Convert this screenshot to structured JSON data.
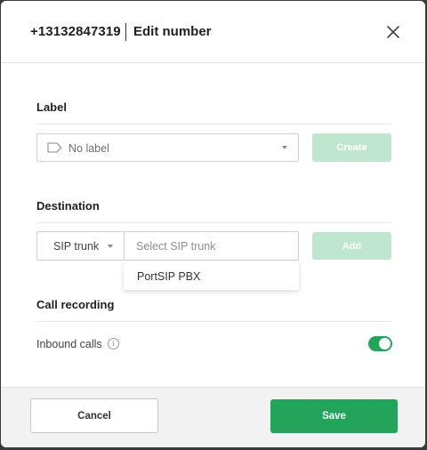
{
  "header": {
    "phone_number": "+13132847319",
    "title": "Edit number"
  },
  "label_section": {
    "title": "Label",
    "select_value": "No label",
    "create_label": "Create"
  },
  "destination_section": {
    "title": "Destination",
    "type_value": "SIP trunk",
    "trunk_placeholder": "Select SIP trunk",
    "add_label": "Add",
    "dropdown_options": [
      "PortSIP PBX"
    ]
  },
  "recording_section": {
    "title": "Call recording",
    "inbound_label": "Inbound calls",
    "inbound_enabled": true
  },
  "footer": {
    "cancel_label": "Cancel",
    "save_label": "Save"
  },
  "colors": {
    "accent": "#22a55b",
    "accent_disabled": "#bfe7cf"
  }
}
